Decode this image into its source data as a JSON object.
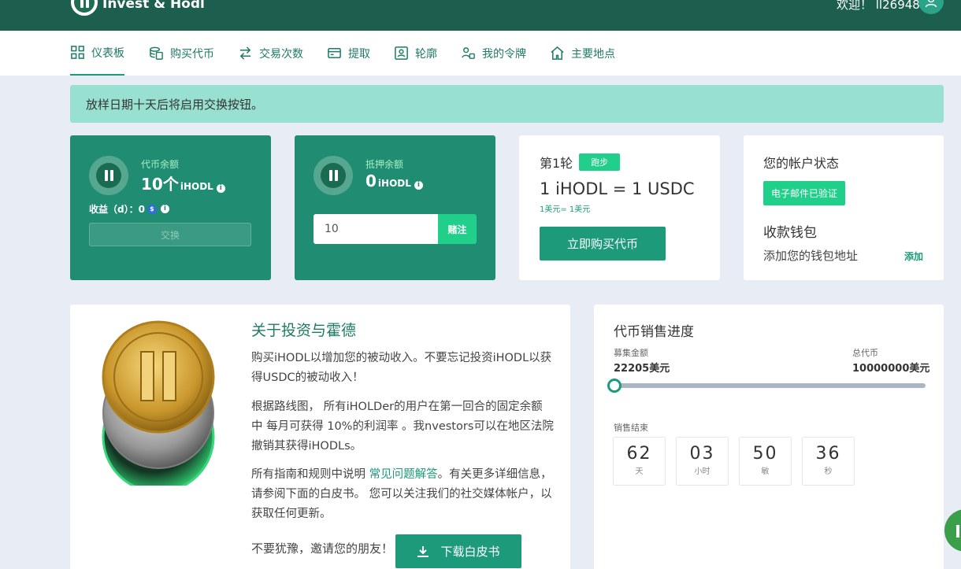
{
  "header": {
    "brand": "Invest & Hodl",
    "welcome": "欢迎！ ll26948"
  },
  "nav": [
    {
      "label": "仪表板",
      "icon": "dashboard-grid-icon",
      "active": true
    },
    {
      "label": "购买代币",
      "icon": "coins-icon"
    },
    {
      "label": "交易次数",
      "icon": "swap-arrows-icon"
    },
    {
      "label": "提取",
      "icon": "wallet-card-icon"
    },
    {
      "label": "轮廓",
      "icon": "profile-icon"
    },
    {
      "label": "我的令牌",
      "icon": "users-token-icon"
    },
    {
      "label": "主要地点",
      "icon": "home-icon"
    }
  ],
  "alert": "放样日期十天后将启用交换按钮。",
  "token_balance": {
    "label": "代币余额",
    "value": "10个",
    "unit": "iHODL",
    "earnings": "收益（d）：0",
    "swap_button": "交换"
  },
  "stake_balance": {
    "label": "抵押余额",
    "value": "0",
    "unit": "iHODL",
    "input_value": "10",
    "stake_button": "赌注"
  },
  "round": {
    "title": "第1轮",
    "status": "跑步",
    "rate": "1 iHODL = 1 USDC",
    "rate_sub": "1美元= 1美元",
    "buy_button": "立即购买代币"
  },
  "account": {
    "title": "您的帐户状态",
    "verified": "电子邮件已验证",
    "wallet_title": "收款钱包",
    "wallet_text": "添加您的钱包地址",
    "wallet_add": "添加"
  },
  "about": {
    "title": "关于投资与霍德",
    "p1": "购买iHODL以增加您的被动收入。不要忘记投资iHODL以获得USDC的被动收入！",
    "p2": "根据路线图， 所有iHOLDer的用户在第一回合的固定余额 中 每月可获得 10%的利润率 。我nvestors可以在地区法院撤销其获得iHODLs。",
    "p3_before": "所有指南和规则中说明 ",
    "p3_link": "常见问题解答",
    "p3_after": "。有关更多详细信息，请参阅下面的白皮书。 您可以关注我们的社交媒体帐户，以获取任何更新。",
    "invite": "不要犹豫，邀请您的朋友！",
    "download_button": "下载白皮书"
  },
  "sale": {
    "title": "代币销售进度",
    "raised_label": "募集金额",
    "raised_value": "22205美元",
    "total_label": "总代币",
    "total_value": "10000000美元",
    "progress_fraction": 0.0022,
    "end_label": "销售结束",
    "countdown": [
      {
        "value": "62",
        "unit": "天"
      },
      {
        "value": "03",
        "unit": "小时"
      },
      {
        "value": "50",
        "unit": "敏"
      },
      {
        "value": "36",
        "unit": "秒"
      }
    ]
  },
  "colors": {
    "header": "#1d5f4f",
    "accent": "#1d9a7a",
    "bright": "#1fcf8a",
    "alert": "#98e1d0"
  }
}
